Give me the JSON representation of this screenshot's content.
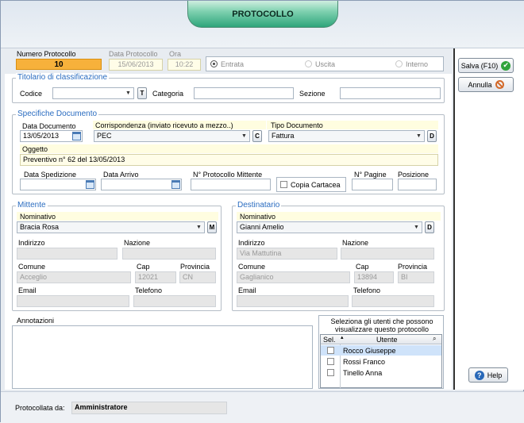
{
  "window": {
    "title": "PROTOCOLLO"
  },
  "protocol": {
    "numero_label": "Numero Protocollo",
    "numero_value": "10",
    "data_label": "Data Protocollo",
    "data_value": "15/06/2013",
    "ora_label": "Ora",
    "ora_value": "10:22",
    "direction_options": [
      "Entrata",
      "Uscita",
      "Interno"
    ],
    "direction_selected": "Entrata"
  },
  "titolario": {
    "legend": "Titolario di classificazione",
    "codice_label": "Codice",
    "codice_value": "",
    "t_button": "T",
    "categoria_label": "Categoria",
    "categoria_value": "",
    "sezione_label": "Sezione",
    "sezione_value": ""
  },
  "specifiche": {
    "legend": "Specifiche Documento",
    "data_documento_label": "Data Documento",
    "data_documento_value": "13/05/2013",
    "corrispondenza_label": "Corrispondenza (inviato ricevuto a mezzo..)",
    "corrispondenza_value": "PEC",
    "c_button": "C",
    "tipo_label": "Tipo Documento",
    "tipo_value": "Fattura",
    "d_button": "D",
    "oggetto_label": "Oggetto",
    "oggetto_value": "Preventivo n° 62 del 13/05/2013",
    "data_spedizione_label": "Data Spedizione",
    "data_arrivo_label": "Data Arrivo",
    "n_protocollo_mittente_label": "N° Protocollo Mittente",
    "copia_cartacea_label": "Copia Cartacea",
    "n_pagine_label": "N° Pagine",
    "posizione_label": "Posizione"
  },
  "mittente": {
    "legend": "Mittente",
    "nominativo_label": "Nominativo",
    "nominativo_value": "Bracia Rosa",
    "m_button": "M",
    "indirizzo_label": "Indirizzo",
    "indirizzo_value": "",
    "nazione_label": "Nazione",
    "nazione_value": "",
    "comune_label": "Comune",
    "comune_value": "Acceglio",
    "cap_label": "Cap",
    "cap_value": "12021",
    "provincia_label": "Provincia",
    "provincia_value": "CN",
    "email_label": "Email",
    "telefono_label": "Telefono"
  },
  "destinatario": {
    "legend": "Destinatario",
    "nominativo_label": "Nominativo",
    "nominativo_value": "Gianni Amelio",
    "d_button": "D",
    "indirizzo_label": "Indirizzo",
    "indirizzo_value": "Via Mattutina",
    "nazione_label": "Nazione",
    "nazione_value": "",
    "comune_label": "Comune",
    "comune_value": "Gaglianico",
    "cap_label": "Cap",
    "cap_value": "13894",
    "provincia_label": "Provincia",
    "provincia_value": "BI",
    "email_label": "Email",
    "telefono_label": "Telefono"
  },
  "annotazioni": {
    "label": "Annotazioni"
  },
  "utenti": {
    "caption": "Seleziona gli utenti che possono visualizzare questo protocollo",
    "col_sel": "Sel.",
    "col_utente": "Utente",
    "rows": [
      "Rocco Giuseppe",
      "Rossi Franco",
      "Tinello Anna"
    ]
  },
  "actions": {
    "salva": "Salva (F10)",
    "annulla": "Annulla",
    "help": "Help"
  },
  "footer": {
    "protocollata_label": "Protocollata da:",
    "protocollata_value": "Amministratore"
  }
}
